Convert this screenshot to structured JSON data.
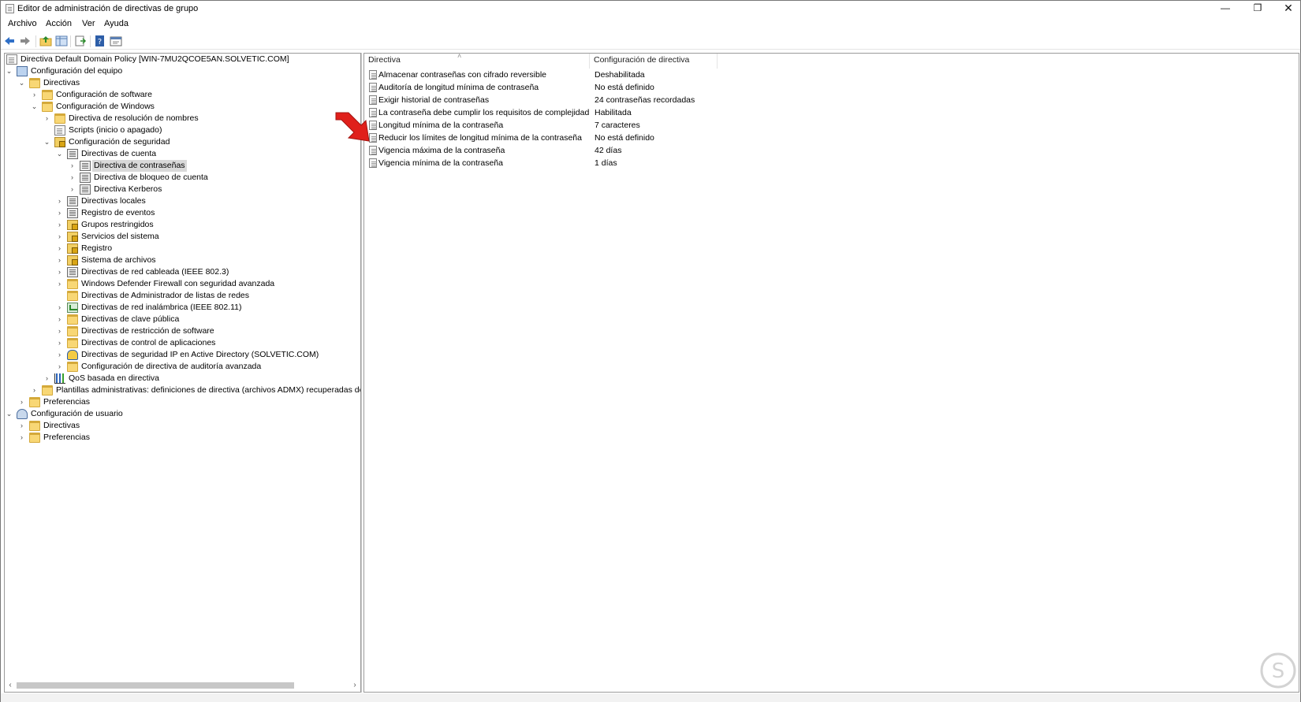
{
  "window": {
    "title": "Editor de administración de directivas de grupo"
  },
  "menu": [
    "Archivo",
    "Acción",
    "Ver",
    "Ayuda"
  ],
  "toolbar": {
    "icons": [
      "back-arrow-icon",
      "forward-arrow-icon",
      "up-folder-icon",
      "show-hide-tree-icon",
      "export-list-icon",
      "help-icon",
      "properties-icon"
    ]
  },
  "tree": {
    "root": "Directiva Default Domain Policy [WIN-7MU2QCOE5AN.SOLVETIC.COM]",
    "comp_config": "Configuración del equipo",
    "directivas": "Directivas",
    "config_software": "Configuración de software",
    "config_windows": "Configuración de Windows",
    "resolucion_nombres": "Directiva de resolución de nombres",
    "scripts": "Scripts (inicio o apagado)",
    "config_seguridad": "Configuración de seguridad",
    "directivas_cuenta": "Directivas de cuenta",
    "directiva_contrasenas": "Directiva de contraseñas",
    "bloqueo_cuenta": "Directiva de bloqueo de cuenta",
    "kerberos": "Directiva Kerberos",
    "locales": "Directivas locales",
    "registro_eventos": "Registro de eventos",
    "grupos_restringidos": "Grupos restringidos",
    "servicios_sistema": "Servicios del sistema",
    "registro": "Registro",
    "sistema_archivos": "Sistema de archivos",
    "red_cableada": "Directivas de red cableada (IEEE 802.3)",
    "firewall": "Windows Defender Firewall con seguridad avanzada",
    "admin_listas_redes": "Directivas de Administrador de listas de redes",
    "red_inalambrica": "Directivas de red inalámbrica (IEEE 802.11)",
    "clave_publica": "Directivas de clave pública",
    "restriccion_software": "Directivas de restricción de software",
    "control_aplicaciones": "Directivas de control de aplicaciones",
    "seguridad_ip": "Directivas de seguridad IP en Active Directory (SOLVETIC.COM)",
    "auditoria_avanzada": "Configuración de directiva de auditoría avanzada",
    "qos": "QoS basada en directiva",
    "plantillas": "Plantillas administrativas: definiciones de directiva (archivos ADMX) recuperadas del",
    "preferencias": "Preferencias",
    "user_config": "Configuración de usuario",
    "user_directivas": "Directivas",
    "user_preferencias": "Preferencias"
  },
  "list": {
    "col_policy": "Directiva",
    "col_setting": "Configuración de directiva",
    "rows": [
      {
        "policy": "Almacenar contraseñas con cifrado reversible",
        "setting": "Deshabilitada"
      },
      {
        "policy": "Auditoría de longitud mínima de contraseña",
        "setting": "No está definido"
      },
      {
        "policy": "Exigir historial de contraseñas",
        "setting": "24 contraseñas recordadas"
      },
      {
        "policy": "La contraseña debe cumplir los requisitos de complejidad",
        "setting": "Habilitada"
      },
      {
        "policy": "Longitud mínima de la contraseña",
        "setting": "7 caracteres"
      },
      {
        "policy": "Reducir los límites de longitud mínima de la contraseña",
        "setting": "No está definido"
      },
      {
        "policy": "Vigencia máxima de la contraseña",
        "setting": "42 días"
      },
      {
        "policy": "Vigencia mínima de la contraseña",
        "setting": "1 días"
      }
    ]
  },
  "colors": {
    "annotation_arrow": "#e0201b",
    "selection": "#d9d9d9"
  }
}
